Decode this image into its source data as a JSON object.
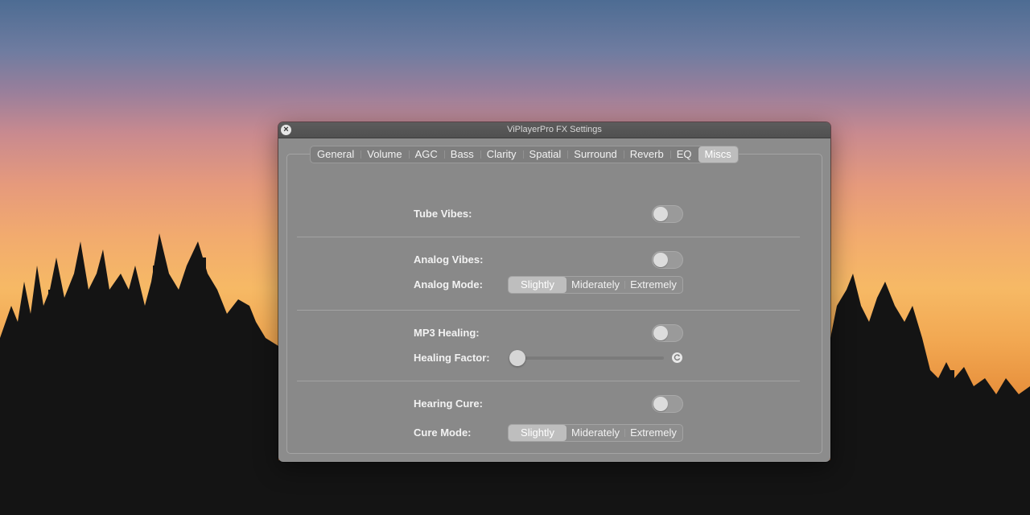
{
  "window": {
    "title": "ViPlayerPro FX Settings",
    "close_icon": "close-icon"
  },
  "tabs": [
    {
      "label": "General"
    },
    {
      "label": "Volume"
    },
    {
      "label": "AGC"
    },
    {
      "label": "Bass"
    },
    {
      "label": "Clarity"
    },
    {
      "label": "Spatial"
    },
    {
      "label": "Surround"
    },
    {
      "label": "Reverb"
    },
    {
      "label": "EQ"
    },
    {
      "label": "Miscs",
      "active": true
    }
  ],
  "settings": {
    "tube_vibes": {
      "label": "Tube Vibes:",
      "enabled": false
    },
    "analog_vibes": {
      "label": "Analog Vibes:",
      "enabled": false
    },
    "analog_mode": {
      "label": "Analog Mode:",
      "options": [
        "Slightly",
        "Miderately",
        "Extremely"
      ],
      "selected": "Slightly"
    },
    "mp3_healing": {
      "label": "MP3 Healing:",
      "enabled": false
    },
    "healing_factor": {
      "label": "Healing Factor:",
      "value_fraction": 0.0,
      "reset_icon": "reset-icon"
    },
    "hearing_cure": {
      "label": "Hearing Cure:",
      "enabled": false
    },
    "cure_mode": {
      "label": "Cure Mode:",
      "options": [
        "Slightly",
        "Miderately",
        "Extremely"
      ],
      "selected": "Slightly"
    }
  },
  "colors": {
    "window_bg": "#8c8c8c",
    "titlebar_bg": "#555555",
    "active_tab_bg": "#bdbdbd",
    "text": "#f2f2f2"
  }
}
